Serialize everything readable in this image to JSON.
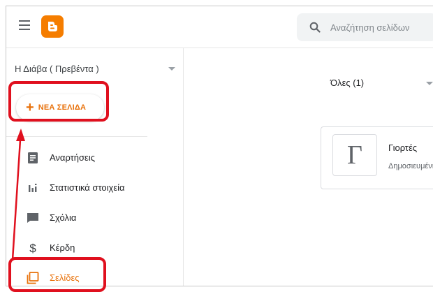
{
  "header": {
    "search_placeholder": "Αναζήτηση σελίδων"
  },
  "sidebar": {
    "blog_name": "Η Διάβα ( Πρεβέντα )",
    "new_page_label": "ΝΕΑ ΣΕΛΙΔΑ",
    "items": [
      {
        "label": "Αναρτήσεις",
        "icon": "posts-icon"
      },
      {
        "label": "Στατιστικά στοιχεία",
        "icon": "stats-icon"
      },
      {
        "label": "Σχόλια",
        "icon": "comments-icon"
      },
      {
        "label": "Κέρδη",
        "icon": "dollar-icon"
      },
      {
        "label": "Σελίδες",
        "icon": "pages-icon"
      }
    ]
  },
  "main": {
    "filter_label": "Όλες (1)",
    "page_card": {
      "thumb_letter": "Γ",
      "title": "Γιορτές",
      "status": "Δημοσιευμένη"
    }
  },
  "colors": {
    "accent": "#e8710a",
    "logo": "#f57d00",
    "annotation": "#e0101e"
  }
}
